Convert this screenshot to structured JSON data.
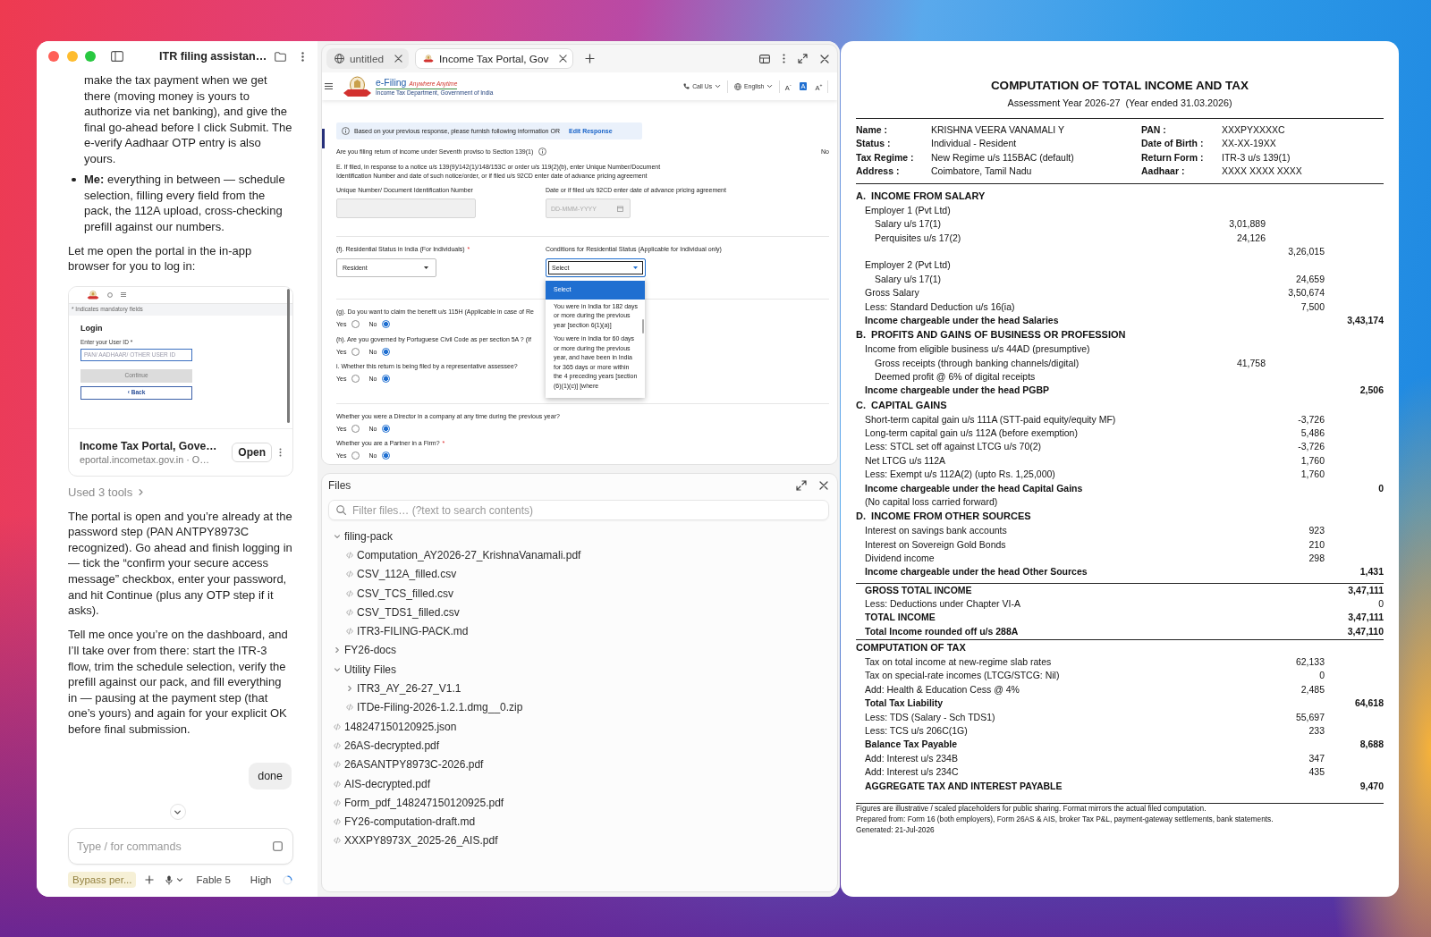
{
  "chat": {
    "title": "ITR filing assistan…",
    "messages": [
      {
        "kind": "bullet_continuation",
        "text": "make the tax payment when we get there (moving money is yours to authorize via net banking), and give the final go-ahead before I click Submit. The e-verify Aadhaar OTP entry is also yours."
      },
      {
        "kind": "bullet_list",
        "items": [
          "**Me:** everything in between — schedule selection, filling every field from the pack, the 112A upload, cross-checking prefill against our numbers."
        ]
      },
      {
        "kind": "paragraph",
        "text": "Let me open the portal in the in-app browser for you to log in:"
      },
      {
        "kind": "link_card",
        "preview": {
          "note": "* Indicates mandatory fields",
          "heading": "Login",
          "field_label": "Enter your User ID *",
          "field_placeholder": "PAN/ AADHAAR/ OTHER USER ID",
          "primary_button": "Continue",
          "secondary_button": "‹ Back"
        },
        "title": "Income Tax Portal, Gove…",
        "url": "eportal.incometax.gov.in · O…",
        "action": "Open"
      },
      {
        "kind": "tool_summary",
        "text": "Used 3 tools"
      },
      {
        "kind": "paragraph",
        "text": "The portal is open and you’re already at the password step (PAN ANTPY8973C recognized). Go ahead and finish logging in — tick the “confirm your secure access message” checkbox, enter your password, and hit Continue (plus any OTP step if it asks)."
      },
      {
        "kind": "paragraph",
        "text": "Tell me once you’re on the dashboard, and I’ll take over from there: start the ITR-3 flow, trim the schedule selection, verify the prefill against our pack, and fill everything in — pausing at the payment step (that one’s yours) and again for your explicit OK before final submission."
      },
      {
        "kind": "user",
        "text": "done"
      }
    ],
    "composer": {
      "placeholder": "Type / for commands"
    },
    "footer": {
      "mode": "Bypass per...",
      "model": "Fable 5",
      "effort": "High"
    }
  },
  "browser": {
    "tabs": [
      {
        "kind": "blank",
        "title": "untitled",
        "selected": false
      },
      {
        "kind": "site",
        "title": "Income Tax Portal, Gov",
        "selected": true
      }
    ],
    "page": {
      "logo": {
        "title": "e-Filing",
        "tagline": "Anywhere Anytime",
        "subtitle": "Income Tax Department, Government of India"
      },
      "header_links": [
        {
          "kind": "phone",
          "label": "Call Us"
        },
        {
          "kind": "language",
          "label": "English"
        }
      ],
      "text_sizes": [
        {
          "label": "A$^{-}$",
          "selected": false
        },
        {
          "label": "A",
          "selected": true
        },
        {
          "label": "A$^{+}$",
          "selected": false
        }
      ],
      "notice": {
        "text": "Based on your previous response, please furnish following information OR",
        "link": "Edit Response"
      },
      "sections": [
        {
          "items": [
            {
              "kind": "answered",
              "question": "Are you filing return of income under Seventh proviso to Section 139(1)",
              "answer": "No"
            },
            {
              "kind": "note",
              "text": "E. If filed, in response to a notice u/s 139(9)/142(1)/148/153C or order u/s 119(2)(b), enter Unique Number/Document Identification Number and date of such notice/order, or if filed u/s 92CD enter date of advance pricing agreement"
            },
            {
              "kind": "field_pair",
              "fields": [
                {
                  "kind": "text",
                  "label": "Unique Number/ Document Identification Number",
                  "disabled": true
                },
                {
                  "kind": "date",
                  "label": "Date or if filed u/s 92CD enter date of advance pricing agreement",
                  "placeholder": "DD-MMM-YYYY",
                  "disabled": true
                }
              ]
            }
          ]
        },
        {
          "items": [
            {
              "kind": "field_pair",
              "fields": [
                {
                  "kind": "select",
                  "label": "(f). Residential Status in India (For Individuals)",
                  "required_mark": "*",
                  "value": "Resident",
                  "expanded": false
                },
                {
                  "kind": "select",
                  "label": "Conditions for Residential Status (Applicable for Individual only)",
                  "value": "Select",
                  "expanded": true,
                  "options": [
                    {
                      "text": "Select",
                      "selected": true
                    },
                    {
                      "text": "You were in India for 182 days or more during the previous year [section 6(1)(a)]",
                      "selected": false
                    },
                    {
                      "text": "You were in India for 60 days or more during the previous year, and have been in India for 365 days or more within the 4 preceding years [section (6)(1)(c)] [where",
                      "selected": false
                    }
                  ]
                }
              ]
            }
          ]
        },
        {
          "items": [
            {
              "kind": "radio",
              "question": "(g). Do you want to claim the benefit u/s 115H (Applicable in case of Re",
              "options": [
                {
                  "label": "Yes",
                  "selected": false
                },
                {
                  "label": "No",
                  "selected": true
                }
              ]
            },
            {
              "kind": "radio",
              "question": "(h). Are you governed by Portuguese Civil Code as per section 5A ? (If",
              "options": [
                {
                  "label": "Yes",
                  "selected": false
                },
                {
                  "label": "No",
                  "selected": true
                }
              ]
            },
            {
              "kind": "radio",
              "question": "i. Whether this return is being filed by a representative assessee?",
              "options": [
                {
                  "label": "Yes",
                  "selected": false
                },
                {
                  "label": "No",
                  "selected": true
                }
              ]
            }
          ]
        },
        {
          "items": [
            {
              "kind": "radio",
              "question": "Whether you were a Director in a company at any time during the previous year?",
              "options": [
                {
                  "label": "Yes",
                  "selected": false
                },
                {
                  "label": "No",
                  "selected": true
                }
              ]
            },
            {
              "kind": "radio",
              "question": "Whether you are a Partner in a Firm?",
              "required_mark": "*",
              "options": [
                {
                  "label": "Yes",
                  "selected": false
                },
                {
                  "label": "No",
                  "selected": true
                }
              ]
            }
          ]
        }
      ]
    }
  },
  "files": {
    "title": "Files",
    "placeholder": "Filter files… (?text to search contents)",
    "tree": [
      {
        "kind": "folder",
        "name": "filing-pack",
        "expanded": true,
        "children": [
          {
            "kind": "file",
            "name": "Computation_AY2026-27_KrishnaVanamali.pdf"
          },
          {
            "kind": "file",
            "name": "CSV_112A_filled.csv"
          },
          {
            "kind": "file",
            "name": "CSV_TCS_filled.csv"
          },
          {
            "kind": "file",
            "name": "CSV_TDS1_filled.csv"
          },
          {
            "kind": "file",
            "name": "ITR3-FILING-PACK.md"
          }
        ]
      },
      {
        "kind": "folder",
        "name": "FY26-docs",
        "expanded": false
      },
      {
        "kind": "folder",
        "name": "Utility Files",
        "expanded": true,
        "children": [
          {
            "kind": "folder",
            "name": "ITR3_AY_26-27_V1.1",
            "expanded": false
          },
          {
            "kind": "file",
            "name": "ITDe-Filing-2026-1.2.1.dmg__0.zip"
          }
        ]
      },
      {
        "kind": "file",
        "name": "148247150120925.json"
      },
      {
        "kind": "file",
        "name": "26AS-decrypted.pdf"
      },
      {
        "kind": "file",
        "name": "26ASANTPY8973C-2026.pdf"
      },
      {
        "kind": "file",
        "name": "AIS-decrypted.pdf"
      },
      {
        "kind": "file",
        "name": "Form_pdf_148247150120925.pdf"
      },
      {
        "kind": "file",
        "name": "FY26-computation-draft.md"
      },
      {
        "kind": "file",
        "name": "XXXPY8973X_2025-26_AIS.pdf"
      }
    ]
  },
  "document": {
    "title": "COMPUTATION OF TOTAL INCOME AND TAX",
    "subtitle": "Assessment Year 2026-27  (Year ended 31.03.2026)",
    "details": [
      {
        "label": "Name :",
        "value": "KRISHNA VEERA VANAMALI Y"
      },
      {
        "label": "PAN :",
        "value": "XXXPYXXXXC"
      },
      {
        "label": "Status :",
        "value": "Individual - Resident"
      },
      {
        "label": "Date of Birth :",
        "value": "XX-XX-19XX"
      },
      {
        "label": "Tax Regime :",
        "value": "New Regime u/s 115BAC (default)"
      },
      {
        "label": "Return Form :",
        "value": "ITR-3 u/s 139(1)"
      },
      {
        "label": "Address :",
        "value": "Coimbatore, Tamil Nadu"
      },
      {
        "label": "Aadhaar :",
        "value": "XXXX XXXX XXXX"
      }
    ],
    "sections": [
      {
        "kind": "head",
        "heading": "A.  INCOME FROM SALARY",
        "rows": [
          {
            "kind": "item",
            "label": "Employer 1 (Pvt Ltd)",
            "children": [
              {
                "kind": "item",
                "label": "Salary u/s 17(1)",
                "amount_1": "3,01,889"
              },
              {
                "kind": "item",
                "label": "Perquisites u/s 17(2)",
                "amount_1": "24,126"
              }
            ]
          },
          {
            "kind": "item",
            "amount_2": "3,26,015"
          },
          {
            "kind": "item",
            "label": "Employer 2 (Pvt Ltd)",
            "children": [
              {
                "kind": "item",
                "label": "Salary u/s 17(1)",
                "amount_2": "24,659"
              }
            ]
          },
          {
            "kind": "item",
            "label": "Gross Salary",
            "amount_2": "3,50,674"
          },
          {
            "kind": "item",
            "label": "Less: Standard Deduction u/s 16(ia)",
            "amount_2": "7,500"
          },
          {
            "kind": "total",
            "label": "Income chargeable under the head Salaries",
            "amount_3": "3,43,174"
          }
        ]
      },
      {
        "kind": "head",
        "heading": "B.  PROFITS AND GAINS OF BUSINESS OR PROFESSION",
        "rows": [
          {
            "kind": "item",
            "label": "Income from eligible business u/s 44AD (presumptive)",
            "children": [
              {
                "kind": "item",
                "label": "Gross receipts (through banking channels/digital)",
                "amount_1": "41,758"
              },
              {
                "kind": "item",
                "label": "Deemed profit @ 6% of digital receipts"
              }
            ]
          },
          {
            "kind": "total",
            "label": "Income chargeable under the head PGBP",
            "amount_3": "2,506"
          }
        ]
      },
      {
        "kind": "head",
        "heading": "C.  CAPITAL GAINS",
        "rows": [
          {
            "kind": "item",
            "label": "Short-term capital gain u/s 111A (STT-paid equity/equity MF)",
            "amount_2": "-3,726"
          },
          {
            "kind": "item",
            "label": "Long-term capital gain u/s 112A (before exemption)",
            "amount_2": "5,486"
          },
          {
            "kind": "item",
            "label": "Less: STCL set off against LTCG u/s 70(2)",
            "amount_2": "-3,726"
          },
          {
            "kind": "item",
            "label": "Net LTCG u/s 112A",
            "amount_2": "1,760"
          },
          {
            "kind": "item",
            "label": "Less: Exempt u/s 112A(2) (upto Rs. 1,25,000)",
            "amount_2": "1,760"
          },
          {
            "kind": "total",
            "label": "Income chargeable under the head Capital Gains",
            "amount_3": "0"
          },
          {
            "kind": "item",
            "label": "(No capital loss carried forward)"
          }
        ]
      },
      {
        "kind": "head",
        "heading": "D.  INCOME FROM OTHER SOURCES",
        "rows": [
          {
            "kind": "item",
            "label": "Interest on savings bank accounts",
            "amount_2": "923"
          },
          {
            "kind": "item",
            "label": "Interest on Sovereign Gold Bonds",
            "amount_2": "210"
          },
          {
            "kind": "item",
            "label": "Dividend income",
            "amount_2": "298"
          },
          {
            "kind": "total",
            "label": "Income chargeable under the head Other Sources",
            "amount_3": "1,431"
          }
        ]
      },
      {
        "kind": "summary",
        "rows": [
          {
            "kind": "total",
            "label": "GROSS TOTAL INCOME",
            "amount_3": "3,47,111"
          },
          {
            "kind": "item",
            "label": "Less: Deductions under Chapter VI-A",
            "amount_3": "0"
          },
          {
            "kind": "total",
            "label": "TOTAL INCOME",
            "amount_3": "3,47,111"
          },
          {
            "kind": "total",
            "label": "Total Income rounded off u/s 288A",
            "amount_3": "3,47,110"
          }
        ]
      },
      {
        "kind": "head",
        "heading": "COMPUTATION OF TAX",
        "rows": [
          {
            "kind": "item",
            "label": "Tax on total income at new-regime slab rates",
            "amount_2": "62,133"
          },
          {
            "kind": "item",
            "label": "Tax on special-rate incomes (LTCG/STCG: Nil)",
            "amount_2": "0"
          },
          {
            "kind": "item",
            "label": "Add: Health & Education Cess @ 4%",
            "amount_2": "2,485"
          },
          {
            "kind": "total",
            "label": "Total Tax Liability",
            "amount_3": "64,618"
          },
          {
            "kind": "item",
            "label": "Less: TDS (Salary - Sch TDS1)",
            "amount_2": "55,697"
          },
          {
            "kind": "item",
            "label": "Less: TCS u/s 206C(1G)",
            "amount_2": "233"
          },
          {
            "kind": "total",
            "label": "Balance Tax Payable",
            "amount_3": "8,688"
          },
          {
            "kind": "item",
            "label": "Add: Interest u/s 234B",
            "amount_2": "347"
          },
          {
            "kind": "item",
            "label": "Add: Interest u/s 234C",
            "amount_2": "435"
          },
          {
            "kind": "total",
            "label": "AGGREGATE TAX AND INTEREST PAYABLE",
            "amount_3": "9,470"
          }
        ]
      }
    ],
    "notes": [
      "Figures are illustrative / scaled placeholders for public sharing. Format mirrors the actual filed computation.",
      "Prepared from: Form 16 (both employers), Form 26AS & AIS, broker Tax P&L, payment-gateway settlements, bank statements.",
      "Generated: 21-Jul-2026"
    ]
  }
}
